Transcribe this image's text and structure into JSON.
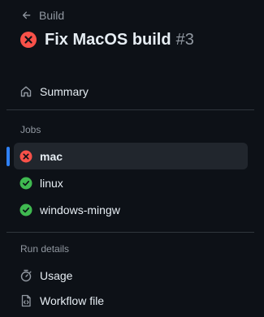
{
  "header": {
    "back_label": "Build",
    "title": "Fix MacOS build",
    "run_number": "#3"
  },
  "nav": {
    "summary": "Summary"
  },
  "jobs": {
    "section_label": "Jobs",
    "items": [
      {
        "label": "mac",
        "status": "failure"
      },
      {
        "label": "linux",
        "status": "success"
      },
      {
        "label": "windows-mingw",
        "status": "success"
      }
    ]
  },
  "run_details": {
    "section_label": "Run details",
    "usage": "Usage",
    "workflow_file": "Workflow file"
  },
  "colors": {
    "failure": "#f85149",
    "success": "#3fb950",
    "accent": "#2f81f7",
    "background": "#0d1117"
  }
}
